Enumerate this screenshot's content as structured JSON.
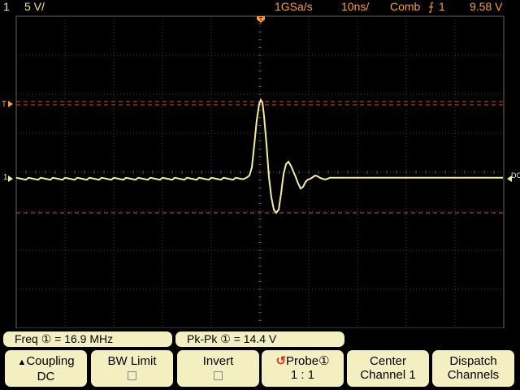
{
  "status_bar": {
    "channel": "1",
    "scale": "5 V/",
    "sample_rate": "1GSa/s",
    "timebase": "10ns/",
    "trigger_mode": "Comb",
    "trigger_channel": "1",
    "trigger_level": "9.58  V"
  },
  "markers": {
    "trigger_top": "T",
    "cursor_left": "T",
    "channel_left": "1",
    "channel_right": "DC"
  },
  "measurements": {
    "freq_label": "Freq",
    "freq_value": "= 16.9 MHz",
    "pkpk_label": "Pk-Pk",
    "pkpk_value": "= 14.4  V"
  },
  "softkeys": [
    {
      "label": "Coupling",
      "value": "DC"
    },
    {
      "label": "BW Limit",
      "value": ""
    },
    {
      "label": "Invert",
      "value": ""
    },
    {
      "label": "Probe",
      "value": "1 : 1"
    },
    {
      "label": "Center",
      "value": "Channel 1"
    },
    {
      "label": "Dispatch",
      "value": "Channels"
    }
  ],
  "colors": {
    "background": "#000000",
    "grid": "#5a5a5a",
    "trace": "#f2ee9e",
    "status_text": "#ff9e2a",
    "cursor": "#d84a32",
    "softkey_bg": "#f4efc0"
  }
}
